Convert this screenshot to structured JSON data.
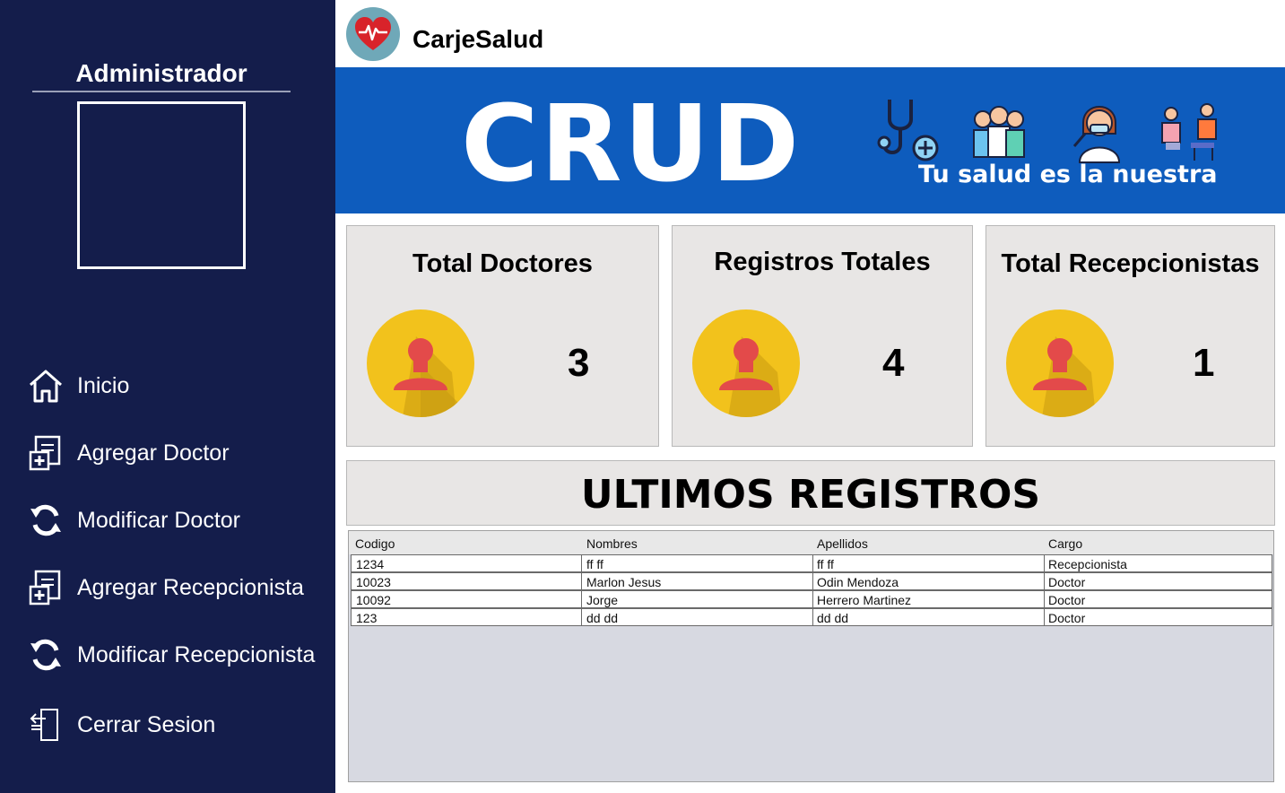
{
  "sidebar": {
    "title": "Administrador",
    "items": [
      {
        "label": "Inicio",
        "icon": "home-icon"
      },
      {
        "label": "Agregar Doctor",
        "icon": "add-doctor-icon"
      },
      {
        "label": "Modificar Doctor",
        "icon": "refresh-icon"
      },
      {
        "label": "Agregar Recepcionista",
        "icon": "add-receptionist-icon"
      },
      {
        "label": "Modificar Recepcionista",
        "icon": "refresh-icon"
      },
      {
        "label": "Cerrar Sesion",
        "icon": "logout-icon"
      }
    ]
  },
  "header": {
    "brand": "CarjeSalud"
  },
  "banner": {
    "title": "CRUD",
    "tagline": "Tu salud es la nuestra"
  },
  "stats": [
    {
      "title": "Total Doctores",
      "value": "3"
    },
    {
      "title": "Registros Totales",
      "value": "4"
    },
    {
      "title": "Total Recepcionistas",
      "value": "1"
    }
  ],
  "recent": {
    "title": "ULTIMOS REGISTROS",
    "columns": [
      "Codigo",
      "Nombres",
      "Apellidos",
      "Cargo"
    ],
    "rows": [
      [
        "1234",
        "ff ff",
        "ff ff",
        "Recepcionista"
      ],
      [
        "10023",
        "Marlon Jesus",
        "Odin Mendoza",
        "Doctor"
      ],
      [
        "10092",
        "Jorge",
        "Herrero Martinez",
        "Doctor"
      ],
      [
        "123",
        "dd dd",
        "dd dd",
        "Doctor"
      ]
    ]
  },
  "colors": {
    "sidebar_bg": "#141d4b",
    "banner_bg": "#0e5cbd",
    "card_bg": "#e8e6e5",
    "stat_circle": "#f2c21c",
    "person_icon": "#e34a4a"
  }
}
